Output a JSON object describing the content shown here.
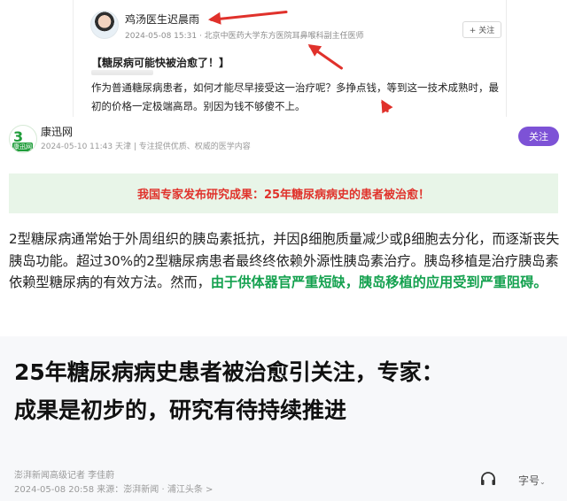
{
  "post": {
    "author": "鸡汤医生迟晨雨",
    "meta": "2024-05-08 15:31 · 北京中医药大学东方医院耳鼻喉科副主任医师",
    "follow_label": "+ 关注",
    "heading": "【糖尿病可能快被治愈了！】",
    "body": "作为普通糖尿病患者，如何才能尽早接受这一治疗呢？多挣点钱，等到这一技术成熟时，最初的价格一定极端高昂。别因为钱不够傻不上。",
    "arrow_color": "#e0312b"
  },
  "article": {
    "logo_mark": "3",
    "logo_sub": "康迅网",
    "author": "康迅网",
    "meta": "2024-05-10 11:43 天津 | 专注提供优质、权威的医学内容",
    "follow_label": "关注",
    "banner": "我国专家发布研究成果：25年糖尿病病史的患者被治愈！",
    "body_plain": "2型糖尿病通常始于外周组织的胰岛素抵抗，并因β细胞质量减少或β细胞去分化，而逐渐丧失胰岛功能。超过30%的2型糖尿病患者最终终依赖外源性胰岛素治疗。胰岛移植是治疗胰岛素依赖型糖尿病的有效方法。然而，",
    "body_highlight": "由于供体器官严重短缺，胰岛移植的应用受到严重阻碍。",
    "colors": {
      "follow_bg": "#7d52d6",
      "banner_bg": "#e8f5e8",
      "banner_text": "#e0322b",
      "highlight": "#14a14f"
    }
  },
  "news": {
    "headline_line1": "25年糖尿病病史患者被治愈引关注，专家：",
    "headline_line2": "成果是初步的，研究有待持续推进",
    "reporter": "澎湃新闻高级记者 李佳蔚",
    "meta": "2024-05-08 20:58 来源：澎湃新闻 · 浦江头条 >",
    "font_size_label": "字号",
    "chevron": "⌄"
  }
}
